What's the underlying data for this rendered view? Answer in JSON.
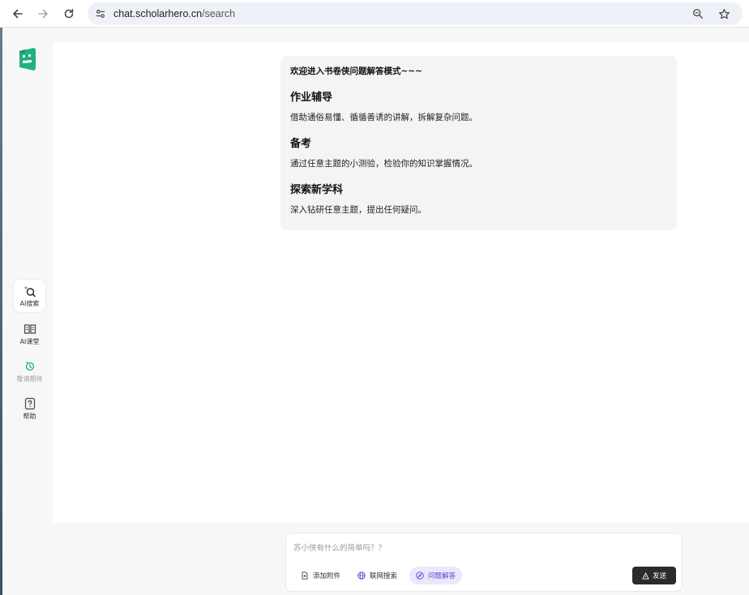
{
  "browser": {
    "url_host": "chat.scholarhero.cn",
    "url_path": "/search"
  },
  "sidebar": {
    "items": [
      {
        "label": "AI搜索",
        "icon": "ai-search-icon",
        "active": true
      },
      {
        "label": "AI课堂",
        "icon": "book-icon",
        "active": false
      },
      {
        "label": "敬请期待",
        "icon": "pending-icon",
        "active": false
      },
      {
        "label": "帮助",
        "icon": "help-icon",
        "active": false
      }
    ]
  },
  "welcome": {
    "title": "欢迎进入书卷侠问题解答模式~~~",
    "sections": [
      {
        "heading": "作业辅导",
        "text": "借助通俗易懂、循循善诱的讲解，拆解复杂问题。"
      },
      {
        "heading": "备考",
        "text": "通过任意主题的小测验，检验你的知识掌握情况。"
      },
      {
        "heading": "探索新学科",
        "text": "深入钻研任意主题，提出任何疑问。"
      }
    ]
  },
  "composer": {
    "placeholder": "苏小侠有什么的简单吗？？",
    "tools": [
      {
        "label": "添加附件",
        "icon": "attachment-icon"
      },
      {
        "label": "联网搜索",
        "icon": "globe-icon"
      },
      {
        "label": "问题解答",
        "icon": "compass-icon",
        "active": true
      }
    ],
    "send_label": "发送"
  },
  "colors": {
    "brand": "#22b07d",
    "accent": "#5b3fd1",
    "send_bg": "#2b2b2b"
  }
}
